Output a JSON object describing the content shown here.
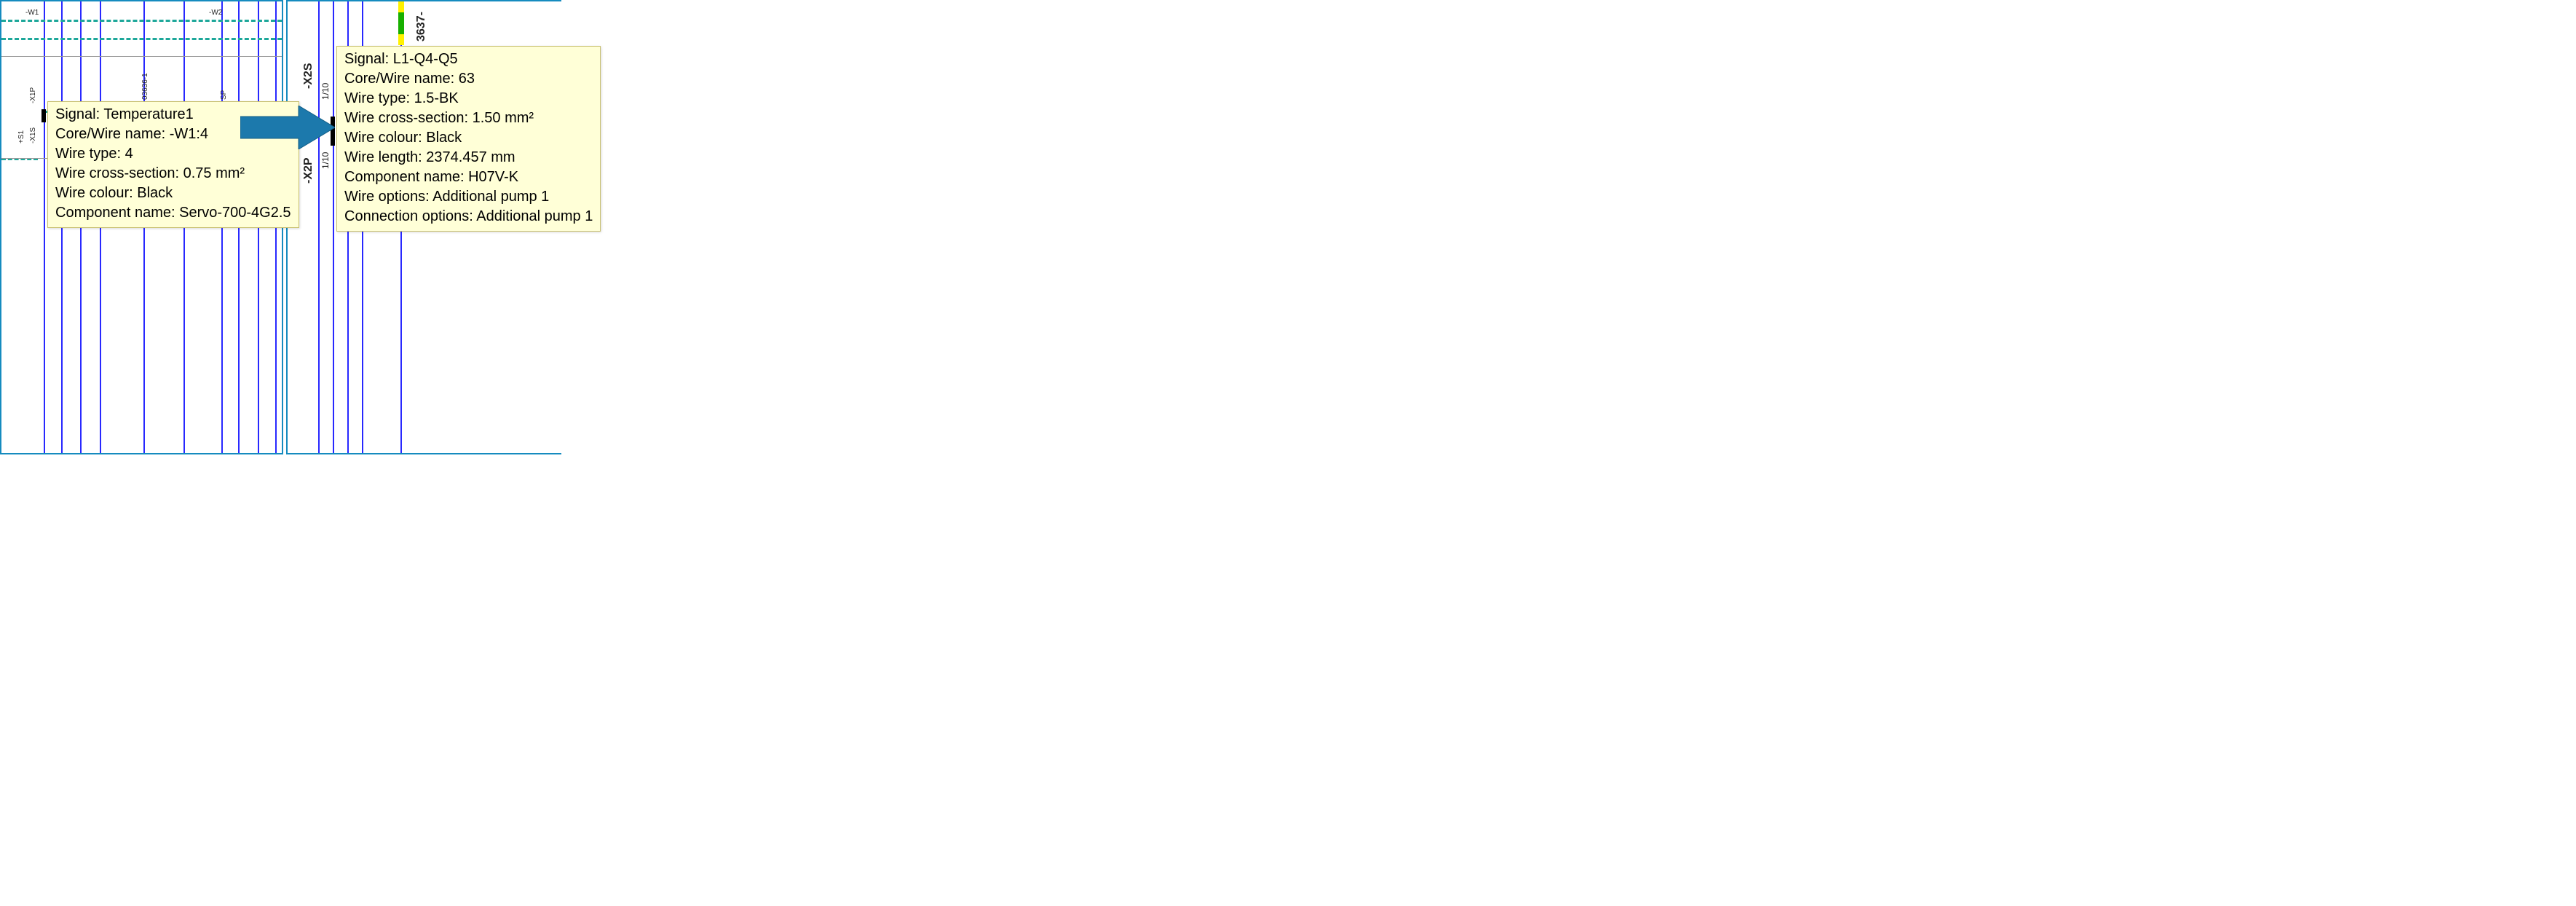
{
  "left": {
    "tags": {
      "w1": "-W1",
      "w2": "-W2",
      "x1p": "-X1P",
      "s1": "+S1",
      "x1s": "-X1S",
      "mid": "03636-1",
      "sp": "SP"
    },
    "tooltip": {
      "signal_label": "Signal:",
      "signal": "Temperature1",
      "core_label": "Core/Wire name:",
      "core": "-W1:4",
      "type_label": "Wire type:",
      "type": "4",
      "cross_label": "Wire cross-section:",
      "cross": "0.75 mm²",
      "colour_label": "Wire colour:",
      "colour": "Black",
      "comp_label": "Component name:",
      "comp": "Servo-700-4G2.5"
    }
  },
  "right": {
    "tags": {
      "x2s": "-X2S",
      "x2p": "-X2P",
      "f1": "1/10",
      "f2": "1/10",
      "bus": "3637-"
    },
    "tooltip": {
      "signal_label": "Signal:",
      "signal": "L1-Q4-Q5",
      "core_label": "Core/Wire name:",
      "core": "63",
      "type_label": "Wire type:",
      "type": "1.5-BK",
      "cross_label": "Wire cross-section:",
      "cross": "1.50 mm²",
      "colour_label": "Wire colour:",
      "colour": "Black",
      "length_label": "Wire length:",
      "length": "2374.457 mm",
      "comp_label": "Component name:",
      "comp": "H07V-K",
      "wopt_label": "Wire options:",
      "wopt": "Additional pump 1",
      "copt_label": "Connection options:",
      "copt": "Additional pump 1"
    }
  }
}
